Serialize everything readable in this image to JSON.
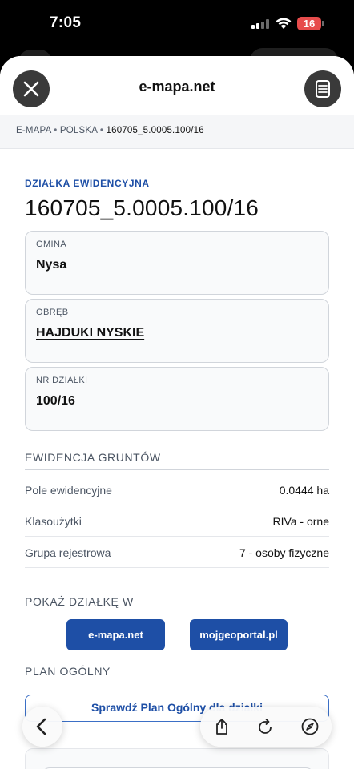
{
  "status_bar": {
    "time": "7:05",
    "battery": "16"
  },
  "sheet": {
    "title": "e-mapa.net"
  },
  "breadcrumb": {
    "items": [
      "E-MAPA",
      "POLSKA",
      "160705_5.0005.100/16"
    ],
    "separator": "•"
  },
  "parcel": {
    "kicker": "DZIAŁKA EWIDENCYJNA",
    "id": "160705_5.0005.100/16",
    "cards": [
      {
        "label": "GMINA",
        "value": "Nysa"
      },
      {
        "label": "OBRĘB",
        "value": "HAJDUKI NYSKIE"
      },
      {
        "label": "NR DZIAŁKI",
        "value": "100/16"
      }
    ]
  },
  "ewidencja": {
    "title": "EWIDENCJA GRUNTÓW",
    "rows": [
      {
        "key": "Pole ewidencyjne",
        "value": "0.0444 ha"
      },
      {
        "key": "Klasoużytki",
        "value": "RIVa - orne"
      },
      {
        "key": "Grupa rejestrowa",
        "value": "7 - osoby fizyczne"
      }
    ]
  },
  "show_in": {
    "title": "POKAŻ DZIAŁKĘ W",
    "buttons": [
      "e-mapa.net",
      "mojgeoportal.pl"
    ]
  },
  "plan": {
    "title": "PLAN OGÓLNY",
    "button": "Sprawdź Plan Ogólny dla działki"
  },
  "colors": {
    "accent": "#1e4fa6",
    "battery": "#e74c4c",
    "sheet_button": "#3a3a3a"
  },
  "icons": [
    "close-icon",
    "sidebar-menu-icon",
    "back-icon",
    "share-icon",
    "reload-icon",
    "compass-icon"
  ]
}
